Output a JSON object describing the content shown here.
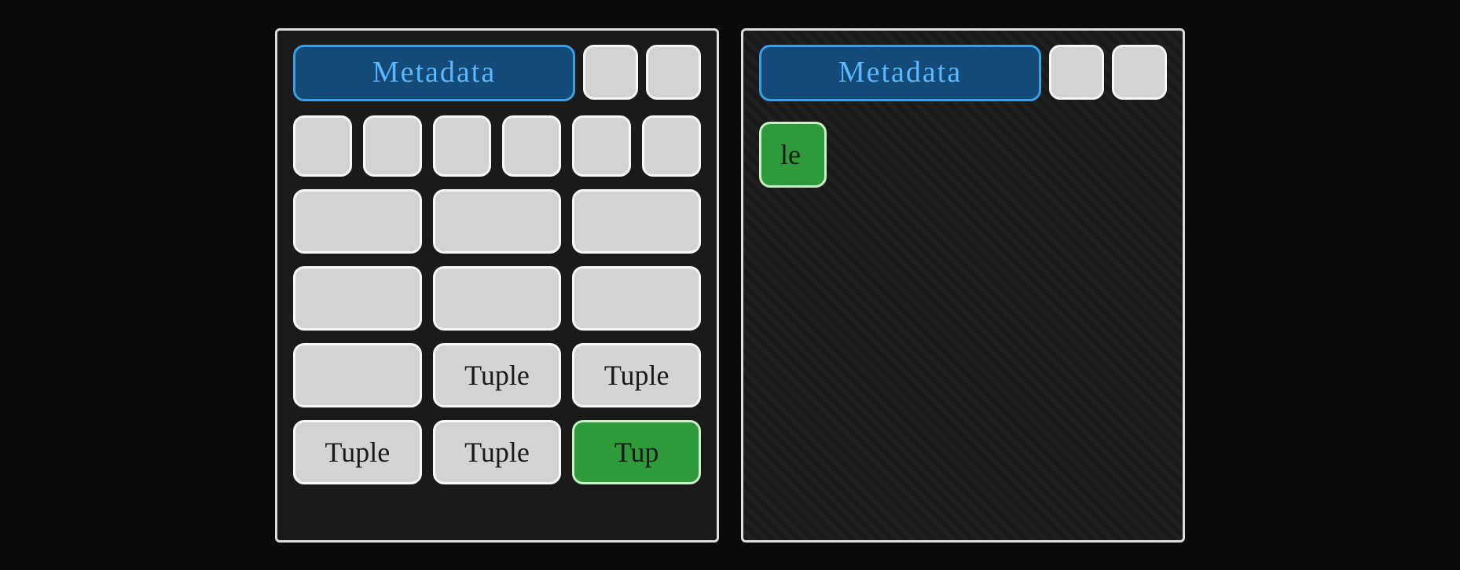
{
  "left": {
    "metadata_label": "Metadata",
    "rows": {
      "r4_c2": "Tuple",
      "r4_c3": "Tuple",
      "r5_c1": "Tuple",
      "r5_c2": "Tuple",
      "r5_c3": "Tup"
    }
  },
  "right": {
    "metadata_label": "Metadata",
    "fragment": "le"
  },
  "notes": {
    "concept": "A tuple/record spans two memory pages; the green block 'Tup' at the bottom-right of the left page continues as 'le' at the top of the right page."
  }
}
